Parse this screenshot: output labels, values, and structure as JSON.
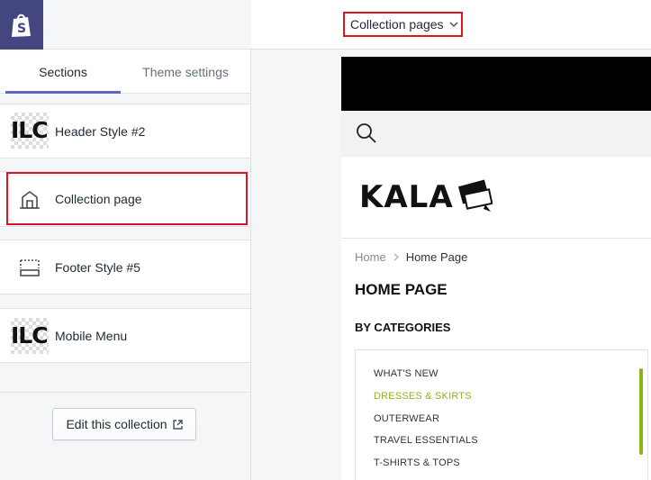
{
  "topbar": {
    "page_selector": "Collection pages"
  },
  "tabs": [
    {
      "label": "Sections"
    },
    {
      "label": "Theme settings"
    }
  ],
  "sections": [
    {
      "label": "Header Style #2",
      "thumb": "ILC"
    },
    {
      "label": "Collection page"
    },
    {
      "label": "Footer Style #5"
    },
    {
      "label": "Mobile Menu",
      "thumb": "ILC"
    }
  ],
  "edit_button": "Edit this collection",
  "preview": {
    "logo": "KALA",
    "breadcrumb": {
      "home": "Home",
      "current": "Home Page"
    },
    "title": "HOME PAGE",
    "by_categories": "BY CATEGORIES",
    "categories": [
      "WHAT'S NEW",
      "DRESSES & SKIRTS",
      "OUTERWEAR",
      "TRAVEL ESSENTIALS",
      "T-SHIRTS & TOPS"
    ],
    "active_category_color": "#8cb31c"
  },
  "colors": {
    "shopify_logo_bg": "#43467f",
    "tab_underline": "#5c6ac4",
    "highlight": "#e0141e"
  }
}
